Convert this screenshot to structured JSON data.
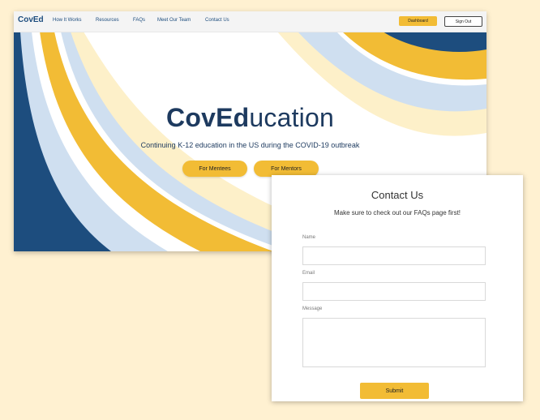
{
  "nav": {
    "brand": "CovEd",
    "links": [
      "How It Works",
      "Resources",
      "FAQs",
      "Meet Our Team",
      "Contact Us"
    ],
    "dashboard_label": "Dashboard",
    "signout_label": "Sign Out"
  },
  "hero": {
    "title_bold": "CovEd",
    "title_rest": "ucation",
    "subtitle": "Continuing K-12 education in the US during the COVID-19 outbreak",
    "buttons": [
      "For Mentees",
      "For Mentors"
    ]
  },
  "contact": {
    "title": "Contact Us",
    "subtitle": "Make sure to check out our FAQs page first!",
    "name_label": "Name",
    "name_value": "",
    "email_label": "Email",
    "email_value": "",
    "message_label": "Message",
    "message_value": "",
    "submit_label": "Submit"
  },
  "colors": {
    "background": "#fff1d1",
    "navy": "#1d4d7e",
    "yellow": "#f2bc35",
    "light_blue": "#cfdff0",
    "cream": "#fdf0c9"
  }
}
